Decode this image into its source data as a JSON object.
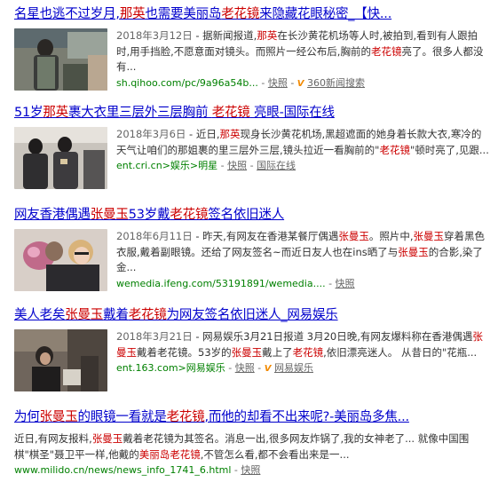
{
  "results": [
    {
      "title_parts": [
        "名星也逃不过岁月,",
        "那英",
        "也需要美丽岛",
        "老花镜",
        "来隐藏花眼秘密_【快..."
      ],
      "date": "2018年3月12日",
      "desc_parts": [
        " - 据新闻报道,",
        "那英",
        "在长沙黄花机场等人时,被拍到,看到有人跟拍时,用手挡脸,不愿意面对镜头。而照片一经公布后,胸前的",
        "老花镜",
        "亮了。很多人都没有..."
      ],
      "url": "sh.qihoo.com/pc/9a96a54b...",
      "snapshot": "快照",
      "source": "360新闻搜索",
      "has_v": true
    },
    {
      "title_parts": [
        "51岁",
        "那英",
        "裹大衣里三层外三层胸前 ",
        "老花镜",
        " 亮眼-国际在线"
      ],
      "date": "2018年3月6日",
      "desc_parts": [
        " - 近日,",
        "那英",
        "现身长沙黄花机场,黑超遮面的她身着长款大衣,寒冷的天气让咱们的那姐裹的里三层外三层,镜头拉近一看胸前的\"",
        "老花镜",
        "\"顿时亮了,见跟..."
      ],
      "url": "ent.cri.cn>娱乐>明星",
      "snapshot": "快照",
      "source": "国际在线",
      "has_v": false
    },
    {
      "title_parts": [
        "网友香港偶遇",
        "张曼玉",
        "53岁戴",
        "老花镜",
        "签名依旧迷人"
      ],
      "date": "2018年6月11日",
      "desc_parts": [
        " - 昨天,有网友在香港某餐厅偶遇",
        "张曼玉",
        "。照片中,",
        "张曼玉",
        "穿着黑色衣服,戴着副眼镜。还给了网友签名~而近日友人也在ins晒了与",
        "张曼玉",
        "的合影,染了金..."
      ],
      "url": "wemedia.ifeng.com/53191891/wemedia....",
      "snapshot": "快照",
      "source": "",
      "has_v": false
    },
    {
      "title_parts": [
        "美人老矣",
        "张曼玉",
        "戴着",
        "老花镜",
        "为网友签名依旧迷人_网易娱乐"
      ],
      "date": "2018年3月21日",
      "desc_parts": [
        " - 网易娱乐3月21日报道 3月20日晚,有网友爆料称在香港偶遇",
        "张曼玉",
        "戴着老花镜。53岁的",
        "张曼玉",
        "戴上了",
        "老花镜",
        ",依旧漂亮迷人。 从昔日的\"花瓶..."
      ],
      "url": "ent.163.com>网易娱乐",
      "snapshot": "快照",
      "source": "网易娱乐",
      "has_v": true
    },
    {
      "title_parts": [
        "为何",
        "张曼玉",
        "的眼镜一看就是",
        "老花镜",
        ",而他的却看不出来呢?-美丽岛多焦..."
      ],
      "date": "",
      "desc_parts": [
        "近日,有网友报料,",
        "张曼玉",
        "戴着老花镜为其签名。消息一出,很多网友炸锅了,我的女神老了... 就像中国围棋\"棋圣\"聂卫平一样,他戴的",
        "美丽岛老花镜",
        ",不管怎么看,都不会看出来是一..."
      ],
      "url": "www.milido.cn/news/news_info_1741_6.html",
      "snapshot": "快照",
      "source": "",
      "has_v": false
    }
  ],
  "v_label": "V",
  "meta_sep": " - ",
  "colors": {
    "link": "#0000cc",
    "highlight": "#cc0000",
    "url": "#008000",
    "text": "#333333"
  }
}
